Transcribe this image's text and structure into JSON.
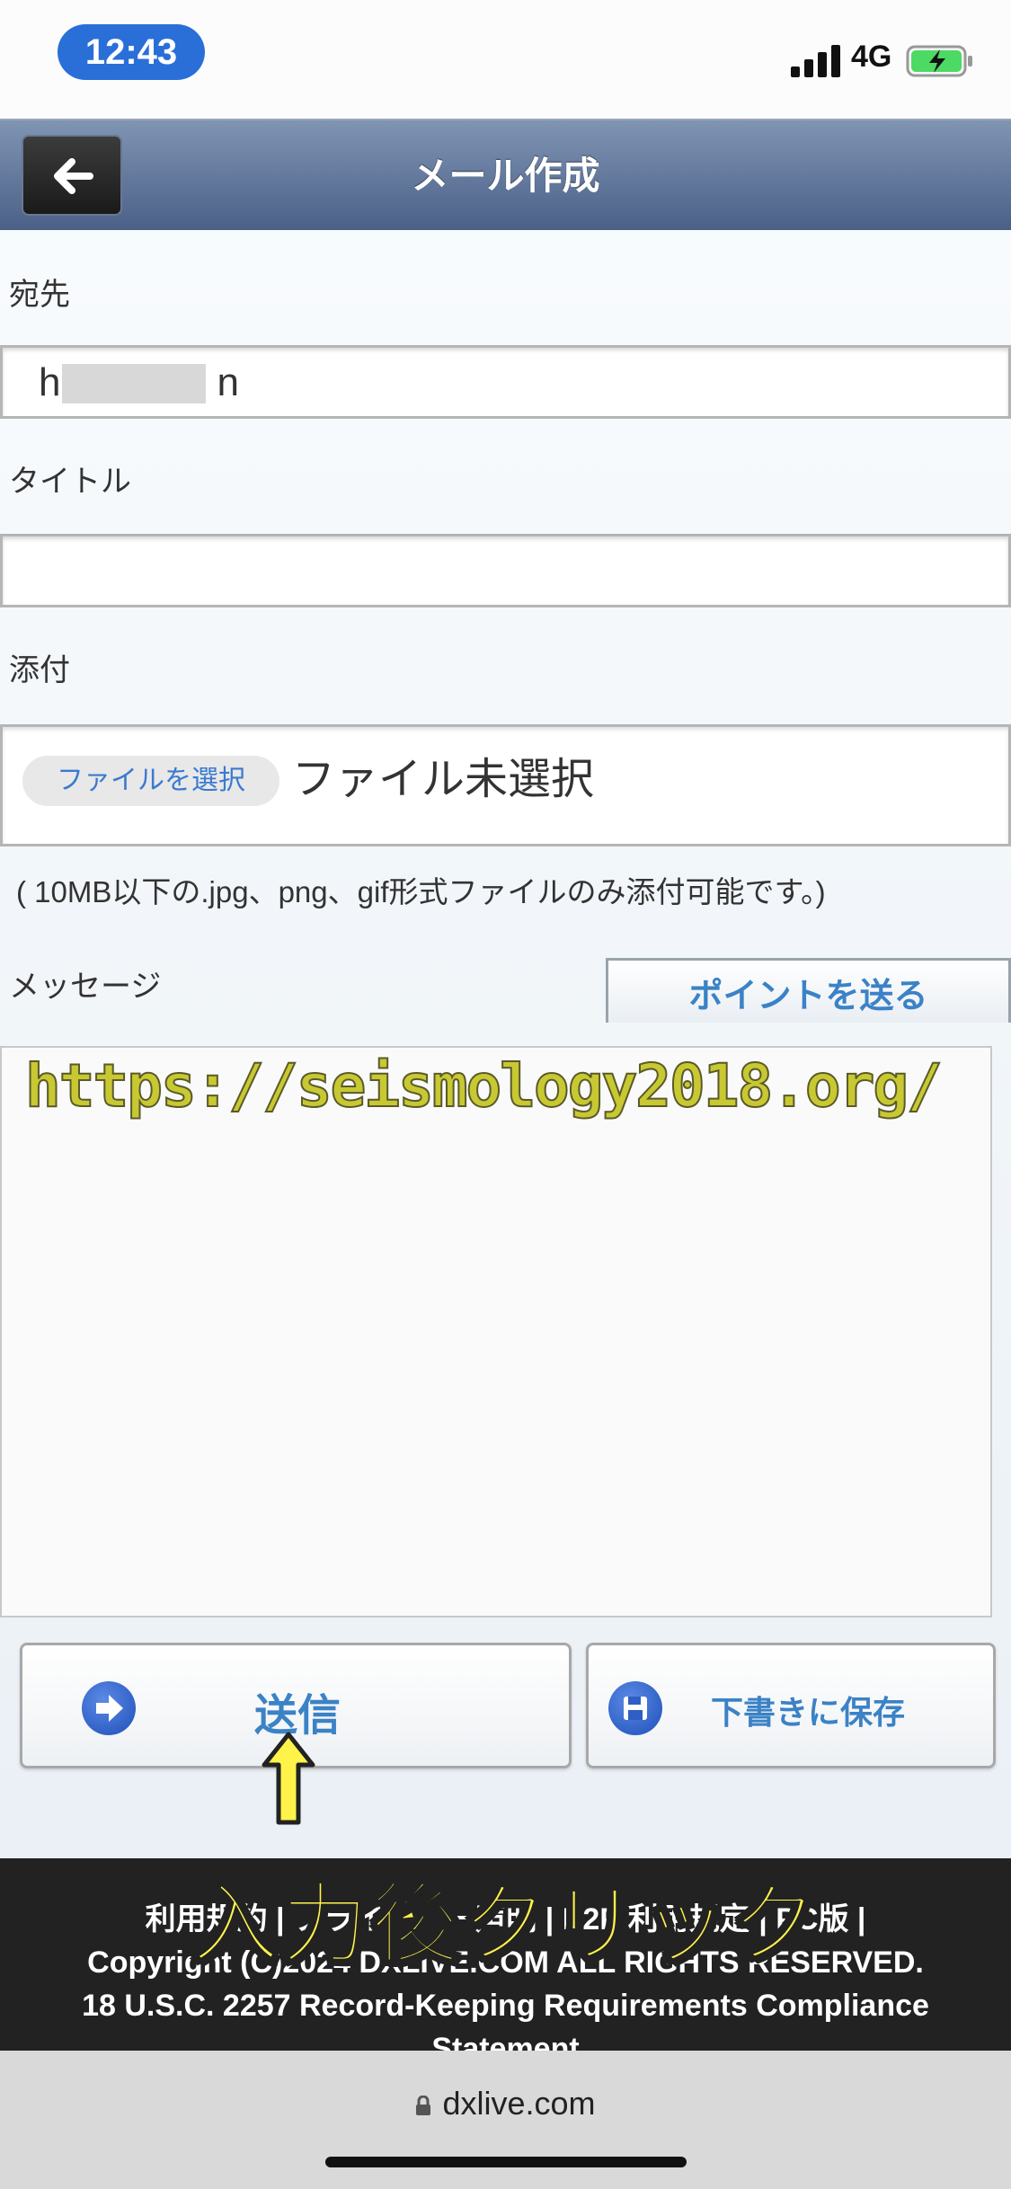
{
  "status_bar": {
    "time": "12:43",
    "network": "4G"
  },
  "header": {
    "title": "メール作成"
  },
  "form": {
    "to_label": "宛先",
    "to_value": "h",
    "to_value_end": "n",
    "title_label": "タイトル",
    "title_value": "",
    "attachment_label": "添付",
    "file_button_label": "ファイルを選択",
    "file_status": "ファイル未選択",
    "attachment_note": "( 10MB以下の.jpg、png、gif形式ファイルのみ添付可能です。)",
    "message_label": "メッセージ",
    "point_button_label": "ポイントを送る",
    "message_value": "https://seismology2018.org/"
  },
  "actions": {
    "send_label": "送信",
    "draft_label": "下書きに保存"
  },
  "footer": {
    "line1": "利用規約 | プライバシー声明 | P2P 利用規定 | PC版 |",
    "line2": "Copyright (C)2024 DXLIVE.COM ALL RIGHTS RESERVED.",
    "line3": "18 U.S.C. 2257 Record-Keeping Requirements Compliance",
    "line4": "Statement"
  },
  "annotation": {
    "overlay_text": "入力後クリック"
  },
  "browser": {
    "domain": "dxlive.com"
  },
  "colors": {
    "accent": "#3b82c6",
    "header_top": "#8095b4",
    "header_bottom": "#4a6087",
    "highlight": "#fff34a"
  }
}
